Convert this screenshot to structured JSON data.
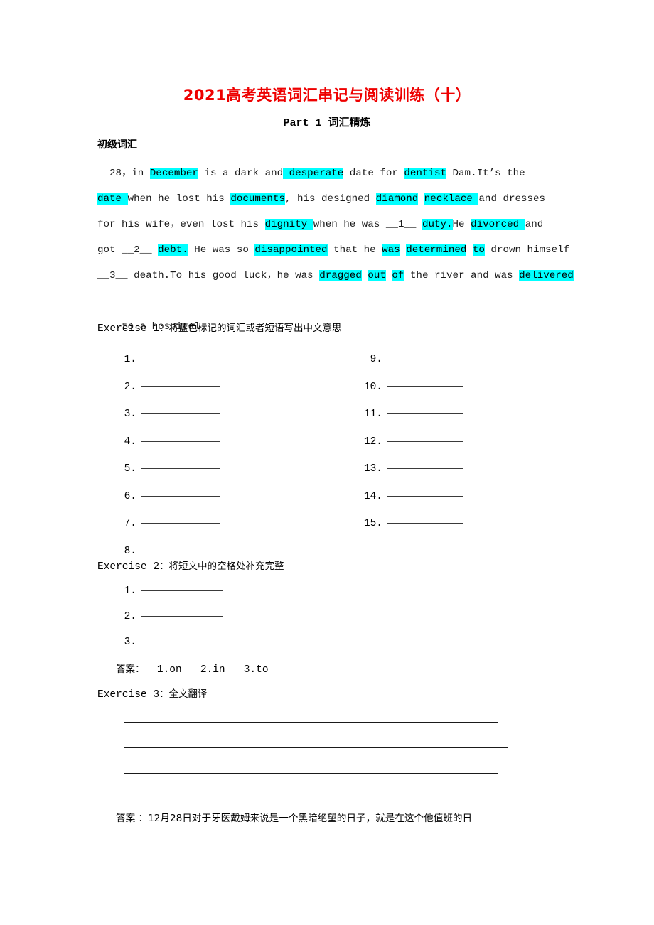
{
  "doc": {
    "title": "2021高考英语词汇串记与阅读训练（十）",
    "part_title": "Part 1 词汇精炼",
    "section_heading": "初级词汇",
    "title_color": "#ee0000",
    "highlight_color": "#00ffff"
  },
  "passage": {
    "lines": [
      [
        {
          "t": "  28，in ",
          "h": false
        },
        {
          "t": "December",
          "h": true
        },
        {
          "t": " is a dark and",
          "h": false
        },
        {
          "t": " desperate",
          "h": true
        },
        {
          "t": " date for ",
          "h": false
        },
        {
          "t": "dentist",
          "h": true
        },
        {
          "t": " Dam.It’s the",
          "h": false
        }
      ],
      [
        {
          "t": "date ",
          "h": true
        },
        {
          "t": "when he lost his ",
          "h": false
        },
        {
          "t": "documents",
          "h": true
        },
        {
          "t": ", his designed ",
          "h": false
        },
        {
          "t": "diamond",
          "h": true
        },
        {
          "t": " ",
          "h": false
        },
        {
          "t": "necklace ",
          "h": true
        },
        {
          "t": "and dresses",
          "h": false
        }
      ],
      [
        {
          "t": "for his wife，even lost his ",
          "h": false
        },
        {
          "t": "dignity ",
          "h": true
        },
        {
          "t": "when he was __1__ ",
          "h": false
        },
        {
          "t": "duty.",
          "h": true
        },
        {
          "t": "He ",
          "h": false
        },
        {
          "t": "divorced ",
          "h": true
        },
        {
          "t": "and",
          "h": false
        }
      ],
      [
        {
          "t": "got __2__ ",
          "h": false
        },
        {
          "t": "debt.",
          "h": true
        },
        {
          "t": " He was so ",
          "h": false
        },
        {
          "t": "disappointed",
          "h": true
        },
        {
          "t": " that he ",
          "h": false
        },
        {
          "t": "was",
          "h": true
        },
        {
          "t": " ",
          "h": false
        },
        {
          "t": "determined",
          "h": true
        },
        {
          "t": " ",
          "h": false
        },
        {
          "t": "to",
          "h": true
        },
        {
          "t": " drown himself",
          "h": false
        }
      ],
      [
        {
          "t": "__3__ death.To his good luck，he was ",
          "h": false
        },
        {
          "t": "dragged",
          "h": true
        },
        {
          "t": " ",
          "h": false
        },
        {
          "t": "out",
          "h": true
        },
        {
          "t": " ",
          "h": false
        },
        {
          "t": "of",
          "h": true
        },
        {
          "t": " the river and was ",
          "h": false
        },
        {
          "t": "delivered",
          "h": true
        }
      ],
      [
        {
          "t": "",
          "h": false
        }
      ],
      [
        {
          "t": "    to a hospital.",
          "h": false
        }
      ]
    ]
  },
  "exercise1": {
    "label_en": "Exercise 1",
    "label_cn": "：将蓝色标记的词汇或者短语写出中文意思",
    "left_items": [
      "1.",
      "2.",
      "3.",
      "4.",
      "5.",
      "6.",
      "7.",
      "8."
    ],
    "right_items": [
      "9.",
      "10.",
      "11.",
      "12.",
      "13.",
      "14.",
      "15."
    ]
  },
  "exercise2": {
    "label_en": "Exercise 2",
    "label_cn": "：将短文中的空格处补充完整",
    "items": [
      "1.",
      "2.",
      "3."
    ],
    "answer": "答案：  1.on   2.in   3.to",
    "answer_cn_prefix": "答案：",
    "answer_values": "  1.on   2.in   3.to"
  },
  "exercise3": {
    "label_en": "Exercise 3",
    "label_cn": "：全文翻译",
    "rule_count": 4,
    "answer_cn_prefix": "答案 ：",
    "answer_text": "12月28日对于牙医戴姆来说是一个黑暗绝望的日子，就是在这个他值班的日"
  }
}
